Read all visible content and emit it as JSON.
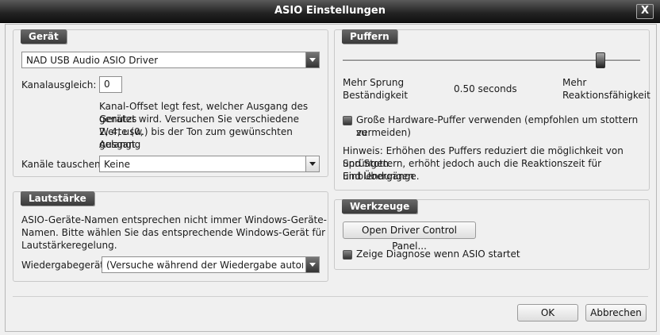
{
  "window": {
    "title": "ASIO Einstellungen",
    "close_label": "X"
  },
  "geraet": {
    "title": "Gerät",
    "driver": "NAD USB Audio ASIO Driver",
    "kanalausgleich_label": "Kanalausgleich:",
    "kanalausgleich_value": "0",
    "help_line1": "Kanal-Offset legt fest, welcher Ausgang des Gerätes",
    "help_line2": "genutzt wird. Versuchen Sie verschiedene Werte (0,",
    "help_line3": "2, 4, usw.) bis der Ton zum gewünschten Ausgang",
    "help_line4": "gelangt.",
    "kanaele_label": "Kanäle tauschen:",
    "kanaele_value": "Keine"
  },
  "lautstaerke": {
    "title": "Lautstärke",
    "text_line1": "ASIO-Geräte-Namen entsprechen nicht immer Windows-Geräte-",
    "text_line2": "Namen. Bitte wählen Sie das entsprechende Windows-Gerät für",
    "text_line3": "Lautstärkeregelung.",
    "wiedergabe_label": "Wiedergabegerät:",
    "wiedergabe_value": "(Versuche während der Wiedergabe automati..."
  },
  "puffer": {
    "title": "Puffern",
    "slider_level": 0.88,
    "left_line1": "Mehr Sprung",
    "left_line2": "Beständigkeit",
    "value": "0.50 seconds",
    "right_line1": "Mehr",
    "right_line2": "Reaktionsfähigkeit",
    "checkbox_line1": "Große Hardware-Puffer verwenden (empfohlen um stottern zu",
    "checkbox_line2": "vermeiden)",
    "hint_line1": "Hinweis: Erhöhen des Puffers reduziert die möglichkeit von Sprüngen",
    "hint_line2": "und Stottern, erhöht jedoch auch die Reaktionszeit für Einblendungen",
    "hint_line3": "und Übergänge."
  },
  "werkzeuge": {
    "title": "Werkzeuge",
    "open_button": "Open Driver Control Panel...",
    "diag_label": "Zeige Diagnose wenn ASIO startet"
  },
  "footer": {
    "ok": "OK",
    "cancel": "Abbrechen"
  }
}
